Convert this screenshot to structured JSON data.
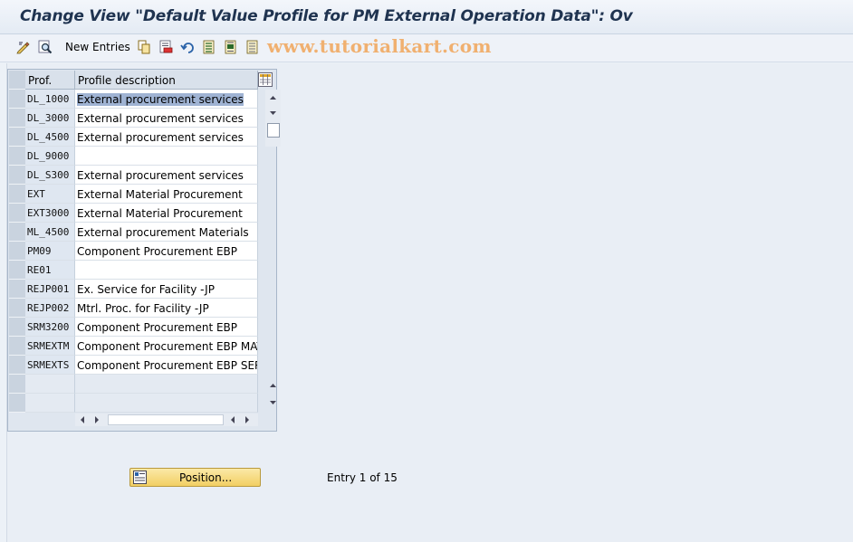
{
  "title": "Change View \"Default Value Profile for PM External Operation Data\": Ov",
  "toolbar": {
    "new_entries_label": "New Entries",
    "icons": [
      "display-change-icon",
      "find-icon",
      "copy-icon",
      "delete-icon",
      "undo-icon",
      "select-all-icon",
      "select-block-icon",
      "deselect-all-icon"
    ]
  },
  "watermark": "www.tutorialkart.com",
  "table": {
    "headers": {
      "prof": "Prof.",
      "desc": "Profile description"
    },
    "rows": [
      {
        "prof": "DL_1000",
        "desc": "External procurement services"
      },
      {
        "prof": "DL_3000",
        "desc": "External procurement services"
      },
      {
        "prof": "DL_4500",
        "desc": "External procurement services"
      },
      {
        "prof": "DL_9000",
        "desc": ""
      },
      {
        "prof": "DL_S300",
        "desc": "External procurement services"
      },
      {
        "prof": "EXT",
        "desc": "External Material Procurement"
      },
      {
        "prof": "EXT3000",
        "desc": "External Material Procurement"
      },
      {
        "prof": "ML_4500",
        "desc": "External procurement Materials"
      },
      {
        "prof": "PM09",
        "desc": "Component Procurement EBP"
      },
      {
        "prof": "RE01",
        "desc": ""
      },
      {
        "prof": "REJP001",
        "desc": "Ex. Service for Facility -JP"
      },
      {
        "prof": "REJP002",
        "desc": "Mtrl. Proc. for Facility -JP"
      },
      {
        "prof": "SRM3200",
        "desc": "Component Procurement EBP"
      },
      {
        "prof": "SRMEXTM",
        "desc": "Component Procurement EBP  MAT"
      },
      {
        "prof": "SRMEXTS",
        "desc": "Component Procurement EBP SERV"
      },
      {
        "prof": "",
        "desc": ""
      },
      {
        "prof": "",
        "desc": ""
      }
    ]
  },
  "footer": {
    "position_label": "Position...",
    "entry_text": "Entry 1 of 15"
  },
  "colors": {
    "accent": "#1f3350",
    "button": "#f2cf63",
    "watermark": "#f0b070"
  }
}
